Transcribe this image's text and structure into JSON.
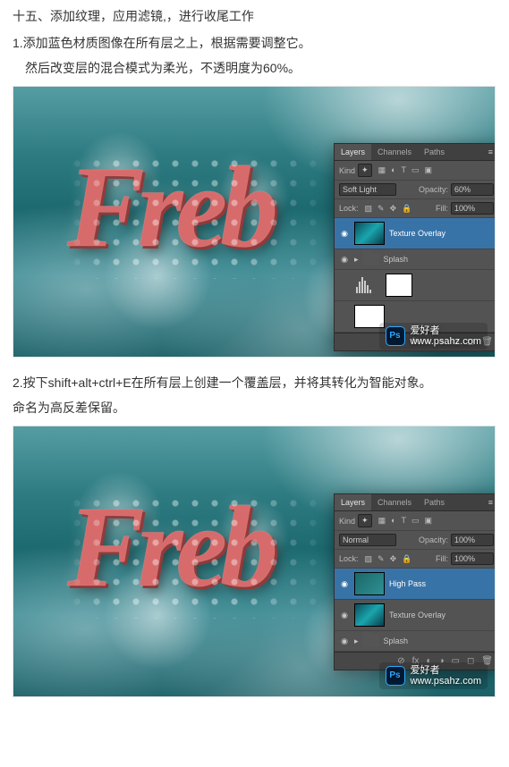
{
  "heading": "十五、添加纹理，应用滤镜,，进行收尾工作",
  "step1": {
    "line1": "1.添加蓝色材质图像在所有层之上，根据需要调整它。",
    "line2": "然后改变层的混合模式为柔光，不透明度为60%。"
  },
  "step2": {
    "line1": "2.按下shift+alt+ctrl+E在所有层上创建一个覆盖层，并将其转化为智能对象。",
    "line2": "命名为高反差保留。"
  },
  "layers_panel": {
    "tabs": {
      "layers": "Layers",
      "channels": "Channels",
      "paths": "Paths"
    },
    "kind_label": "Kind",
    "opacity_label": "Opacity:",
    "lock_label": "Lock:",
    "fill_label": "Fill:",
    "panel1": {
      "blend_mode": "Soft Light",
      "opacity": "60%",
      "fill": "100%",
      "layers": [
        {
          "name": "Texture Overlay"
        },
        {
          "name": "Splash"
        }
      ]
    },
    "panel2": {
      "blend_mode": "Normal",
      "opacity": "100%",
      "fill": "100%",
      "layers": [
        {
          "name": "High Pass"
        },
        {
          "name": "Texture Overlay"
        },
        {
          "name": "Splash"
        }
      ]
    }
  },
  "watermark": {
    "ps": "Ps",
    "name": "爱好者",
    "url": "www.psahz.com"
  },
  "colors": {
    "panel_bg": "#535353",
    "selection": "#3873a8",
    "ocean": "#2b808a",
    "text3d": "#d76b6b"
  }
}
